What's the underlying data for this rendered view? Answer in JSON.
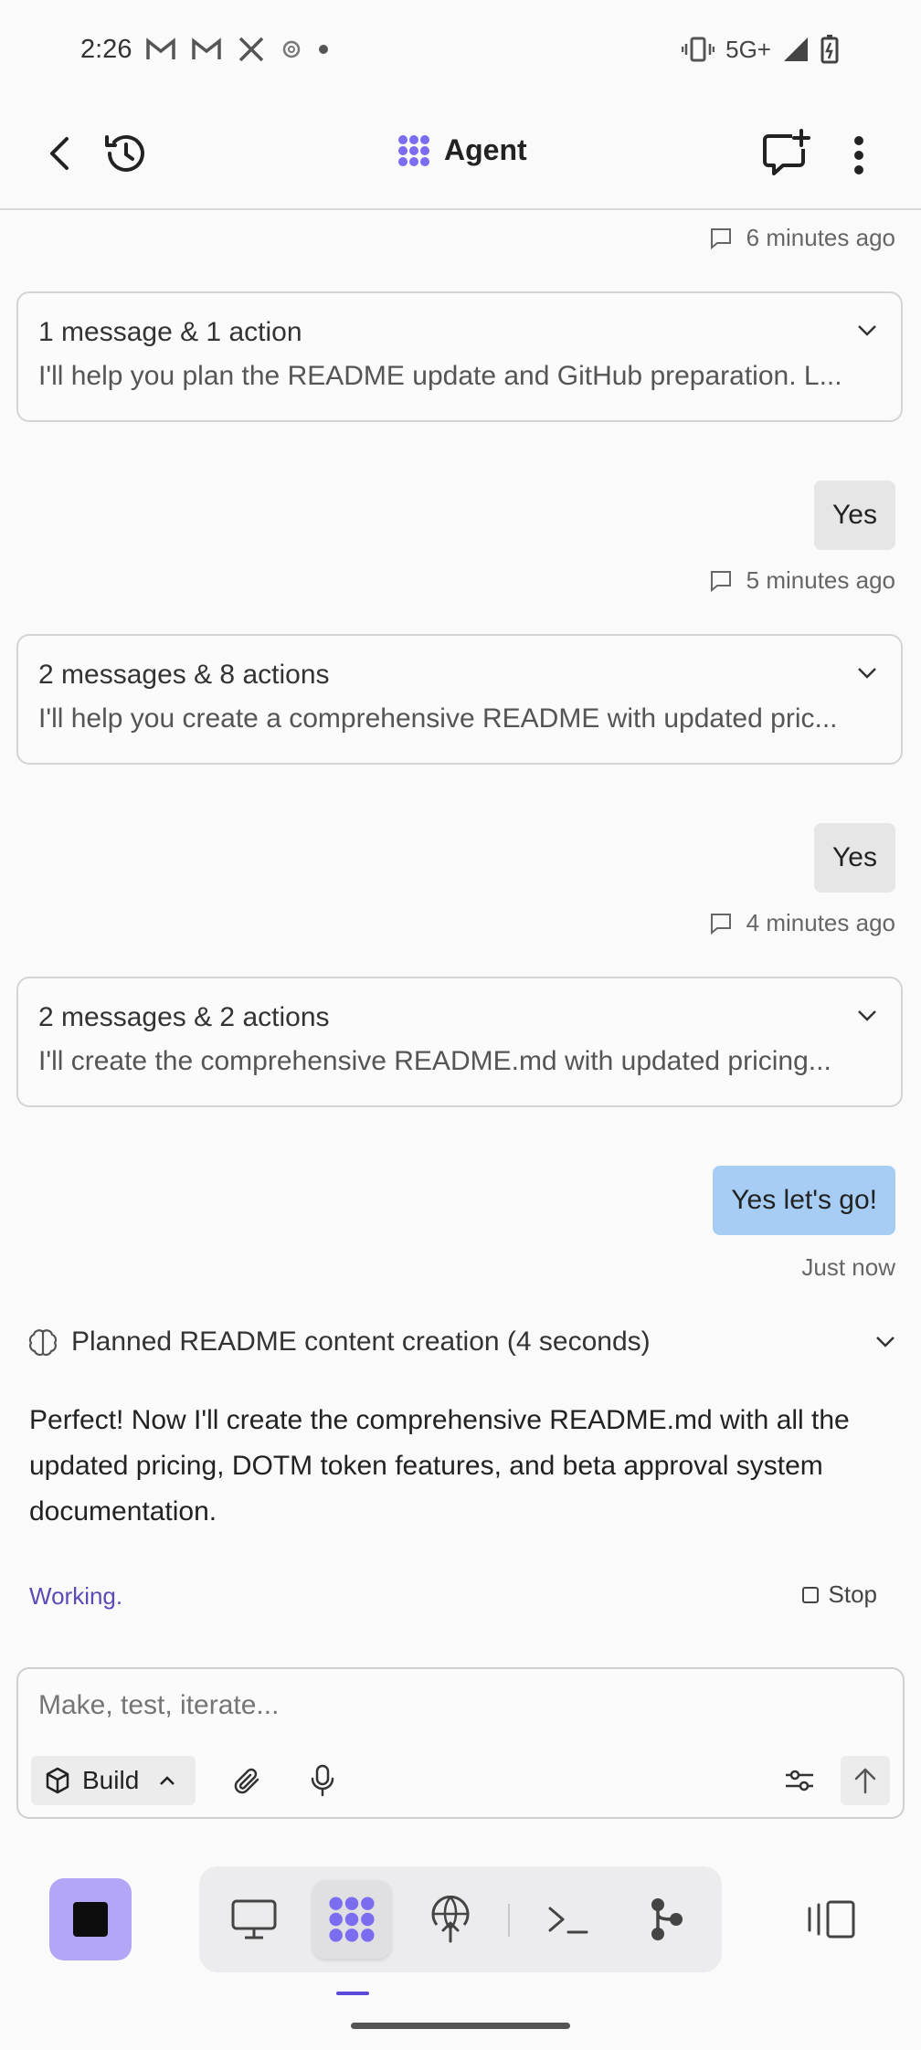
{
  "status_bar": {
    "time": "2:26",
    "network": "5G+"
  },
  "header": {
    "title": "Agent"
  },
  "messages": [
    {
      "kind": "timestamp",
      "text": "6 minutes ago"
    },
    {
      "kind": "card",
      "title": "1 message & 1 action",
      "preview": "I'll help you plan the README update and GitHub preparation. L..."
    },
    {
      "kind": "user",
      "text": "Yes"
    },
    {
      "kind": "timestamp",
      "text": "5 minutes ago"
    },
    {
      "kind": "card",
      "title": "2 messages & 8 actions",
      "preview": "I'll help you create a comprehensive README with updated pric..."
    },
    {
      "kind": "user",
      "text": "Yes"
    },
    {
      "kind": "timestamp",
      "text": "4 minutes ago"
    },
    {
      "kind": "card",
      "title": "2 messages & 2 actions",
      "preview": "I'll create the comprehensive README.md with updated pricing..."
    },
    {
      "kind": "user",
      "text": "Yes let's go!"
    },
    {
      "kind": "timestamp",
      "text": "Just now"
    }
  ],
  "plan": {
    "label": "Planned README content creation (4 seconds)"
  },
  "assistant_message": "Perfect! Now I'll create the comprehensive README.md with all the updated pricing, DOTM token features, and beta approval system documentation.",
  "status": {
    "working": "Working.",
    "stop_label": "Stop"
  },
  "composer": {
    "placeholder": "Make, test, iterate...",
    "mode_label": "Build"
  },
  "colors": {
    "accent": "#7b6cf0",
    "stop_button": "#b3a6f7",
    "user_bubble_latest": "#a7cdf5",
    "working_text": "#5b4bb7"
  }
}
